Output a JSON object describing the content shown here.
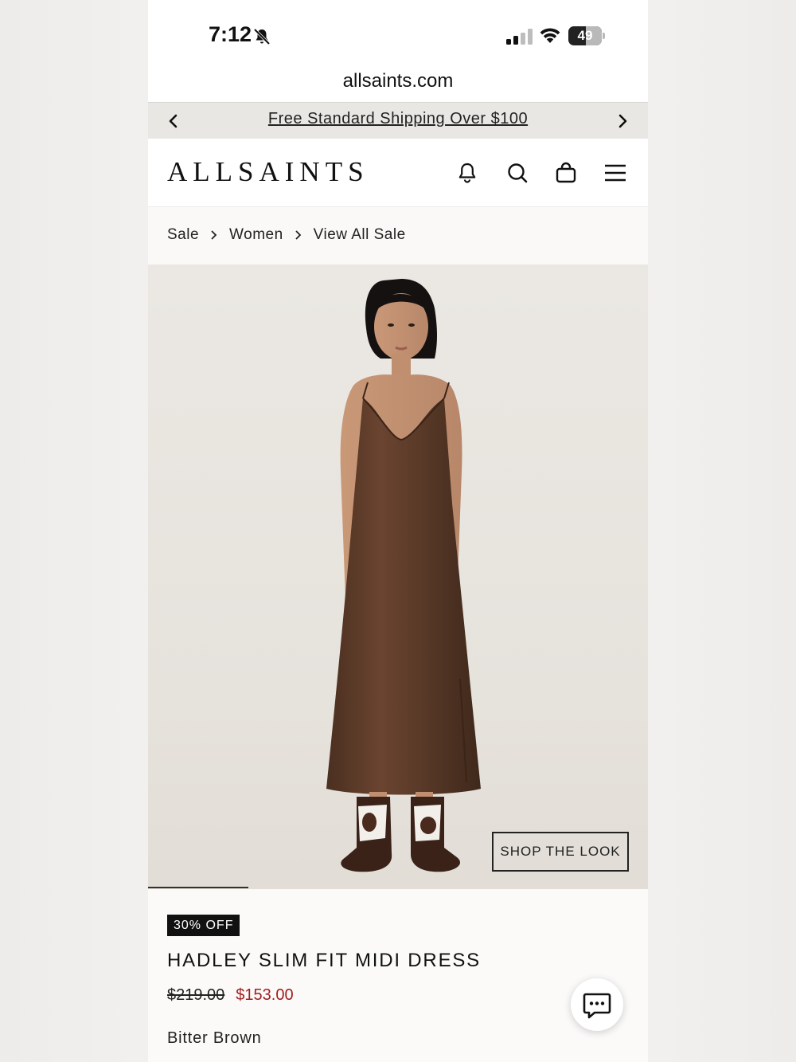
{
  "status_bar": {
    "time": "7:12",
    "battery": "49",
    "icons": [
      "bell-slash-icon",
      "cellular-signal-icon",
      "wifi-icon",
      "battery-icon"
    ]
  },
  "browser": {
    "url": "allsaints.com"
  },
  "promo": {
    "text": "Free Standard Shipping Over $100",
    "icons": [
      "chevron-left-icon",
      "chevron-right-icon"
    ]
  },
  "header": {
    "logo": "ALLSAINTS",
    "icons": [
      "bell-icon",
      "search-icon",
      "shopping-bag-icon",
      "menu-icon"
    ]
  },
  "breadcrumb": {
    "items": [
      "Sale",
      "Women",
      "View All Sale"
    ]
  },
  "hero": {
    "shop_the_look": "SHOP THE LOOK",
    "gallery_progress_fraction": 0.2
  },
  "product": {
    "badge": "30% OFF",
    "name": "HADLEY SLIM FIT MIDI DRESS",
    "original_price": "$219.00",
    "sale_price": "$153.00",
    "color": "Bitter Brown"
  },
  "colors": {
    "sale_price": "#a01e1e",
    "promo_bg": "#e8e7e4",
    "badge_bg": "#111111",
    "dress": "#5a3a28"
  }
}
